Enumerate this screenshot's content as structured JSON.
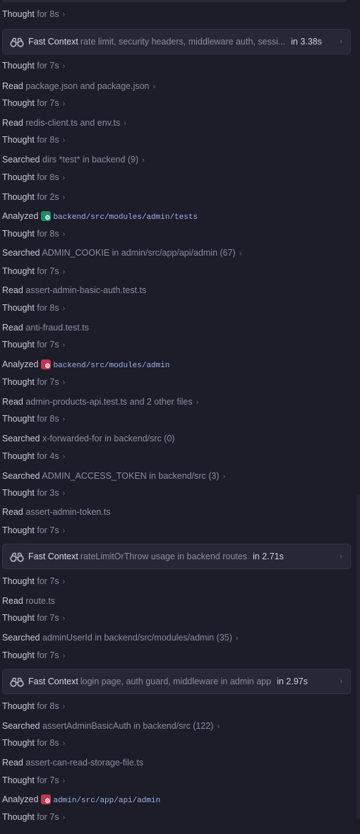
{
  "colors": {
    "background": "#1d1c29",
    "card_background": "#282737",
    "verb_text": "#c9c8d6",
    "detail_text": "#8d8c9e",
    "code_text": "#9fb3e8",
    "icon_green": "#1e8a6e",
    "icon_red": "#c0354f"
  },
  "items": [
    {
      "kind": "row",
      "verb": "Thought",
      "detail": "for 8s",
      "chevron": "›"
    },
    {
      "kind": "card",
      "icon": "binoculars-icon",
      "title": "Fast Context",
      "query": "rate limit, security headers, middleware auth, sessi...",
      "time": "in 3.38s",
      "chevron": "›"
    },
    {
      "kind": "row",
      "verb": "Thought",
      "detail": "for 7s",
      "chevron": "›"
    },
    {
      "kind": "row",
      "verb": "Read",
      "detail": "package.json and package.json",
      "chevron": "›"
    },
    {
      "kind": "row",
      "verb": "Thought",
      "detail": "for 7s",
      "chevron": "›"
    },
    {
      "kind": "row",
      "verb": "Read",
      "detail": "redis-client.ts and env.ts",
      "chevron": "›"
    },
    {
      "kind": "row",
      "verb": "Thought",
      "detail": "for 8s",
      "chevron": "›"
    },
    {
      "kind": "row",
      "verb": "Searched",
      "detail": "dirs *test* in backend (9)",
      "chevron": "›"
    },
    {
      "kind": "row",
      "verb": "Thought",
      "detail": "for 8s",
      "chevron": "›"
    },
    {
      "kind": "row",
      "verb": "Thought",
      "detail": "for 2s",
      "chevron": "›"
    },
    {
      "kind": "row",
      "verb": "Analyzed",
      "icon": "folder-green",
      "path": "backend/src/modules/admin/tests"
    },
    {
      "kind": "row",
      "verb": "Thought",
      "detail": "for 8s",
      "chevron": "›"
    },
    {
      "kind": "row",
      "verb": "Searched",
      "detail": "ADMIN_COOKIE in admin/src/app/api/admin (67)",
      "chevron": "›"
    },
    {
      "kind": "row",
      "verb": "Thought",
      "detail": "for 7s",
      "chevron": "›"
    },
    {
      "kind": "row",
      "verb": "Read",
      "detail": "assert-admin-basic-auth.test.ts"
    },
    {
      "kind": "row",
      "verb": "Thought",
      "detail": "for 8s",
      "chevron": "›"
    },
    {
      "kind": "row",
      "verb": "Read",
      "detail": "anti-fraud.test.ts"
    },
    {
      "kind": "row",
      "verb": "Thought",
      "detail": "for 7s",
      "chevron": "›"
    },
    {
      "kind": "row",
      "verb": "Analyzed",
      "icon": "folder-red",
      "path": "backend/src/modules/admin"
    },
    {
      "kind": "row",
      "verb": "Thought",
      "detail": "for 7s",
      "chevron": "›"
    },
    {
      "kind": "row",
      "verb": "Read",
      "detail": "admin-products-api.test.ts and 2 other files",
      "chevron": "›"
    },
    {
      "kind": "row",
      "verb": "Thought",
      "detail": "for 8s",
      "chevron": "›"
    },
    {
      "kind": "row",
      "verb": "Searched",
      "detail": "x-forwarded-for in backend/src (0)"
    },
    {
      "kind": "row",
      "verb": "Thought",
      "detail": "for 4s",
      "chevron": "›"
    },
    {
      "kind": "row",
      "verb": "Searched",
      "detail": "ADMIN_ACCESS_TOKEN in backend/src (3)",
      "chevron": "›"
    },
    {
      "kind": "row",
      "verb": "Thought",
      "detail": "for 3s",
      "chevron": "›"
    },
    {
      "kind": "row",
      "verb": "Read",
      "detail": "assert-admin-token.ts"
    },
    {
      "kind": "row",
      "verb": "Thought",
      "detail": "for 7s",
      "chevron": "›"
    },
    {
      "kind": "card",
      "icon": "binoculars-icon",
      "title": "Fast Context",
      "query": "rateLimitOrThrow usage in backend routes",
      "time": "in 2.71s",
      "chevron": "›"
    },
    {
      "kind": "row",
      "verb": "Thought",
      "detail": "for 7s",
      "chevron": "›"
    },
    {
      "kind": "row",
      "verb": "Read",
      "detail": "route.ts"
    },
    {
      "kind": "row",
      "verb": "Thought",
      "detail": "for 7s",
      "chevron": "›"
    },
    {
      "kind": "row",
      "verb": "Searched",
      "detail": "adminUserId in backend/src/modules/admin (35)",
      "chevron": "›"
    },
    {
      "kind": "row",
      "verb": "Thought",
      "detail": "for 7s",
      "chevron": "›"
    },
    {
      "kind": "card",
      "icon": "binoculars-icon",
      "title": "Fast Context",
      "query": "login page, auth guard, middleware in admin app",
      "time": "in 2.97s",
      "chevron": "›"
    },
    {
      "kind": "row",
      "verb": "Thought",
      "detail": "for 8s",
      "chevron": "›"
    },
    {
      "kind": "row",
      "verb": "Searched",
      "detail": "assertAdminBasicAuth in backend/src (122)",
      "chevron": "›"
    },
    {
      "kind": "row",
      "verb": "Thought",
      "detail": "for 8s",
      "chevron": "›"
    },
    {
      "kind": "row",
      "verb": "Read",
      "detail": "assert-can-read-storage-file.ts"
    },
    {
      "kind": "row",
      "verb": "Thought",
      "detail": "for 7s",
      "chevron": "›"
    },
    {
      "kind": "row",
      "verb": "Analyzed",
      "icon": "folder-red",
      "path": "admin/src/app/api/admin"
    },
    {
      "kind": "row",
      "verb": "Thought",
      "detail": "for 7s",
      "chevron": "›"
    }
  ]
}
